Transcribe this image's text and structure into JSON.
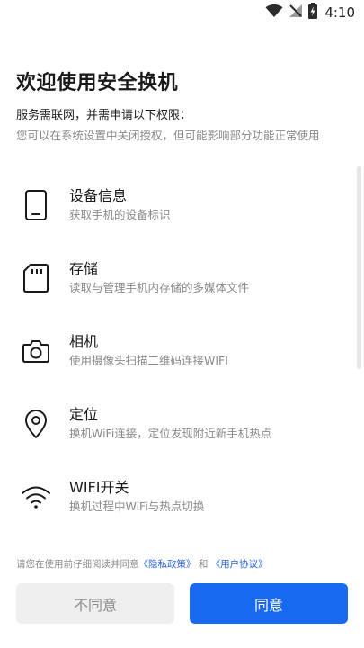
{
  "status_bar": {
    "time": "4:10",
    "icons": [
      "wifi-icon",
      "no-signal-icon",
      "battery-charging-icon"
    ]
  },
  "header": {
    "title": "欢迎使用安全换机",
    "subtitle": "服务需联网，并需申请以下权限：",
    "note": "您可以在系统设置中关闭授权，但可能影响部分功能正常使用"
  },
  "permissions": [
    {
      "icon": "phone-icon",
      "name": "设备信息",
      "desc": "获取手机的设备标识"
    },
    {
      "icon": "sd-card-icon",
      "name": "存储",
      "desc": "读取与管理手机内存储的多媒体文件"
    },
    {
      "icon": "camera-icon",
      "name": "相机",
      "desc": "使用摄像头扫描二维码连接WIFI"
    },
    {
      "icon": "location-icon",
      "name": "定位",
      "desc": "换机WiFi连接，定位发现附近新手机热点"
    },
    {
      "icon": "wifi-icon",
      "name": "WIFI开关",
      "desc": "换机过程中WiFi与热点切换"
    }
  ],
  "consent": {
    "prefix": "请您在使用前仔细阅读并同意",
    "privacy_link": "《隐私政策》",
    "and": "和",
    "user_link": "《用户协议》"
  },
  "buttons": {
    "disagree": "不同意",
    "agree": "同意"
  },
  "colors": {
    "accent": "#1769f0",
    "link": "#2a63d8",
    "secondary_text": "#8a8a8a",
    "disabled_button_bg": "#efefef"
  }
}
